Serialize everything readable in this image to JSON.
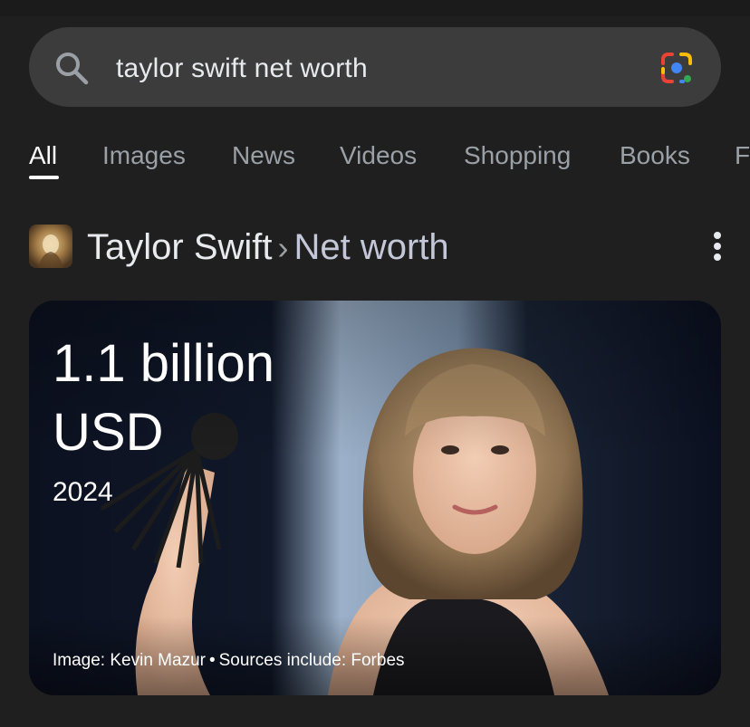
{
  "search": {
    "query": "taylor swift net worth",
    "icon": "search-icon",
    "lens_icon": "google-lens-icon"
  },
  "tabs": [
    {
      "label": "All",
      "active": true
    },
    {
      "label": "Images",
      "active": false
    },
    {
      "label": "News",
      "active": false
    },
    {
      "label": "Videos",
      "active": false
    },
    {
      "label": "Shopping",
      "active": false
    },
    {
      "label": "Books",
      "active": false
    },
    {
      "label": "F",
      "active": false
    }
  ],
  "entity": {
    "name": "Taylor Swift",
    "separator": "›",
    "attribute": "Net worth",
    "menu_icon": "more-vertical-icon"
  },
  "hero": {
    "value_line1": "1.1 billion",
    "value_line2": "USD",
    "year": "2024",
    "image_credit": "Image: Kevin Mazur",
    "credit_separator": "•",
    "sources": "Sources include: Forbes"
  },
  "colors": {
    "background": "#1f1f1f",
    "search_bar": "#3c3c3c",
    "tab_inactive": "#9aa0a6",
    "tab_active": "#ffffff",
    "attribute_text": "#c4c7d8"
  }
}
